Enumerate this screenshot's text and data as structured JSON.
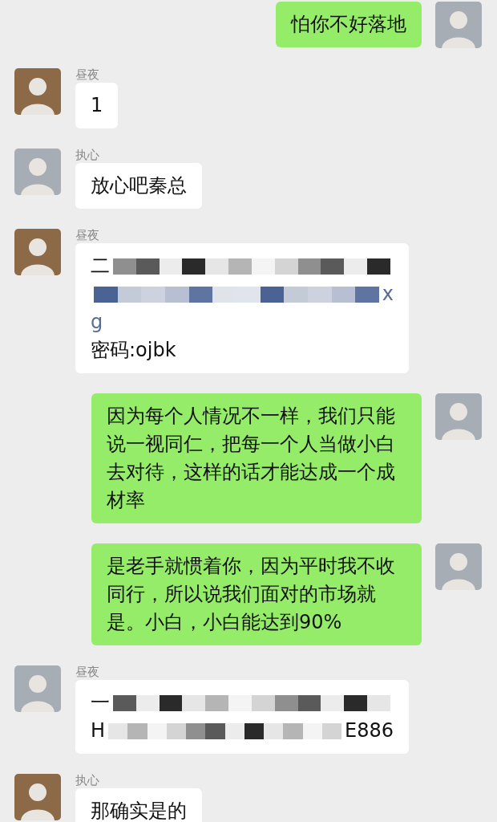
{
  "messages": [
    {
      "outgoing": true,
      "kind": "text",
      "text": "怕你不好落地"
    },
    {
      "outgoing": false,
      "kind": "text",
      "sender": "昼夜",
      "text": "1"
    },
    {
      "outgoing": false,
      "kind": "text",
      "sender": "执心",
      "text": "放心吧秦总"
    },
    {
      "outgoing": false,
      "kind": "redacted",
      "sender": "昼夜",
      "lines": [
        {
          "start": "二",
          "masked": true,
          "link": false
        },
        {
          "end": "x",
          "masked": true,
          "link": true
        },
        {
          "start": "g",
          "masked": false,
          "link": true
        },
        {
          "start": "密码:ojbk",
          "masked": false,
          "link": false
        }
      ]
    },
    {
      "outgoing": true,
      "kind": "text",
      "text": "因为每个人情况不一样，我们只能说一视同仁，把每一个人当做小白去对待，这样的话才能达成一个成材率"
    },
    {
      "outgoing": true,
      "kind": "text",
      "text": "是老手就惯着你，因为平时我不收同行，所以说我们面对的市场就是。小白，小白能达到90%"
    },
    {
      "outgoing": false,
      "kind": "redacted",
      "sender": "昼夜",
      "lines": [
        {
          "start": "一",
          "masked": true,
          "link": false
        },
        {
          "start": "H",
          "end": "E886",
          "masked": true,
          "link": false
        }
      ]
    },
    {
      "outgoing": false,
      "kind": "text",
      "sender": "执心",
      "text": "那确实是的"
    }
  ]
}
